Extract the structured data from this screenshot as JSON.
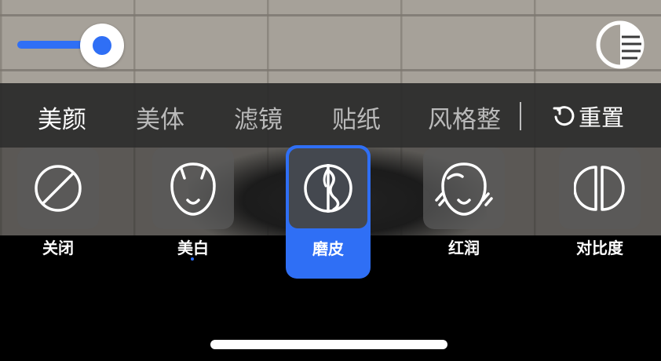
{
  "slider": {
    "value_fraction": 0.6,
    "accent": "#2f6ff5"
  },
  "compare_button": {
    "icon": "compare-icon"
  },
  "tabs": [
    {
      "label": "美颜",
      "active": true
    },
    {
      "label": "美体",
      "active": false
    },
    {
      "label": "滤镜",
      "active": false
    },
    {
      "label": "贴纸",
      "active": false
    },
    {
      "label": "风格整",
      "active": false
    }
  ],
  "reset": {
    "label": "重置",
    "icon": "reset-icon"
  },
  "options": [
    {
      "label": "关闭",
      "icon": "off-icon",
      "selected": false
    },
    {
      "label": "美白",
      "icon": "whiten-icon",
      "selected": false,
      "indicator": true
    },
    {
      "label": "磨皮",
      "icon": "smooth-skin-icon",
      "selected": true
    },
    {
      "label": "红润",
      "icon": "rosy-icon",
      "selected": false
    },
    {
      "label": "对比度",
      "icon": "contrast-icon",
      "selected": false
    }
  ]
}
